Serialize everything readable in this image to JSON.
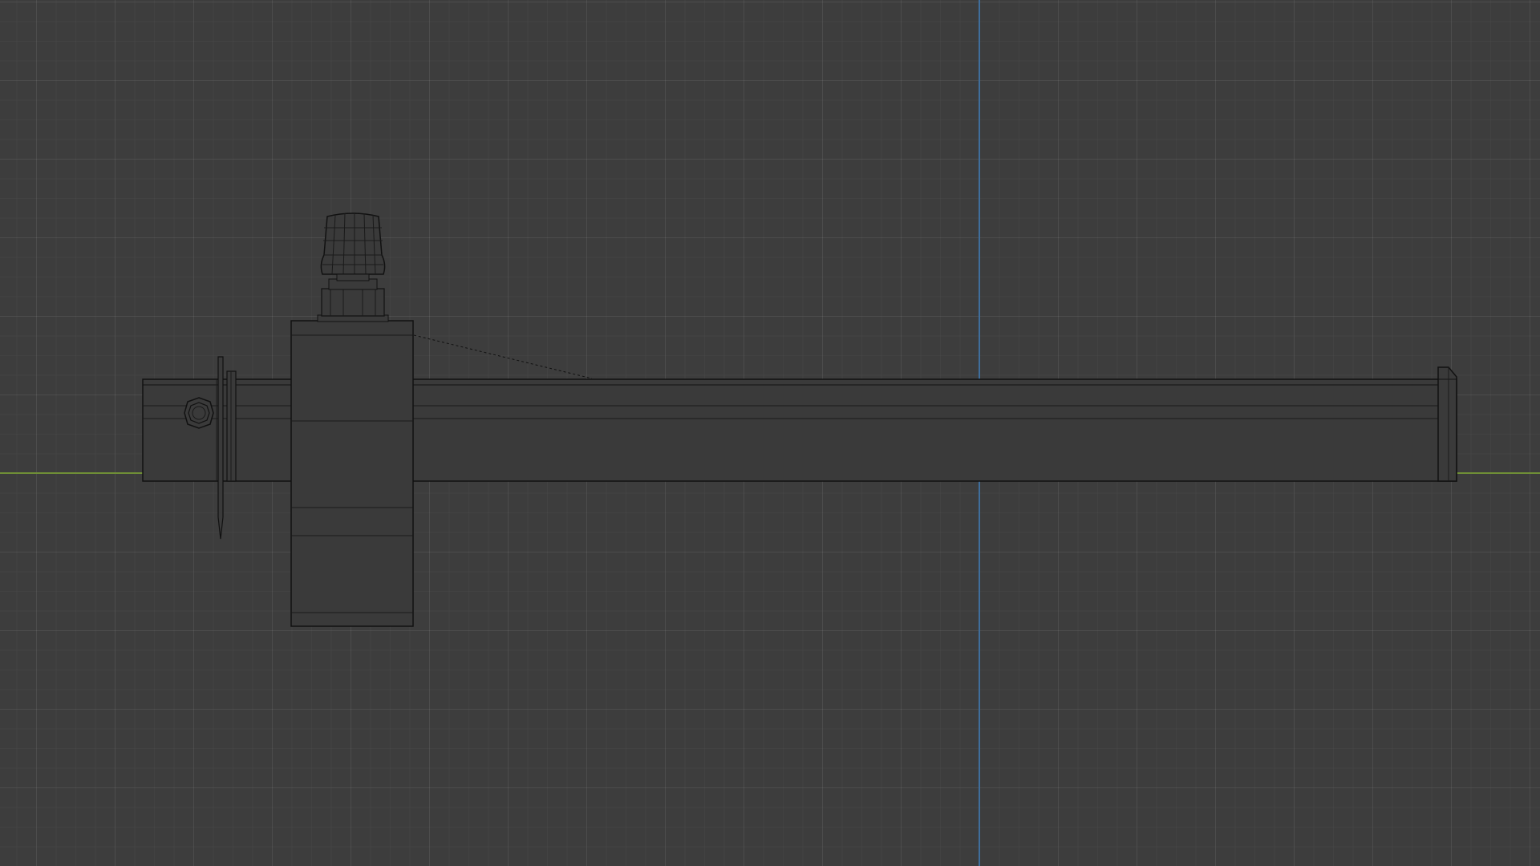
{
  "viewport": {
    "background": "#3d3d3d",
    "x_axis_color": "#6f8f36",
    "y_axis_color": "#3f6e9c",
    "wire_color": "#111111",
    "mesh_fill": "#3a3a3a",
    "mesh_face_light": "#404040"
  },
  "objects": {
    "beam": {
      "name": "marking-gauge-beam"
    },
    "fence": {
      "name": "marking-gauge-fence"
    },
    "thumb_screw": {
      "name": "thumb-screw-knob"
    },
    "pin": {
      "name": "scribing-pin"
    },
    "end_cap": {
      "name": "beam-end-cap"
    },
    "bolt": {
      "name": "hex-bolt"
    }
  }
}
